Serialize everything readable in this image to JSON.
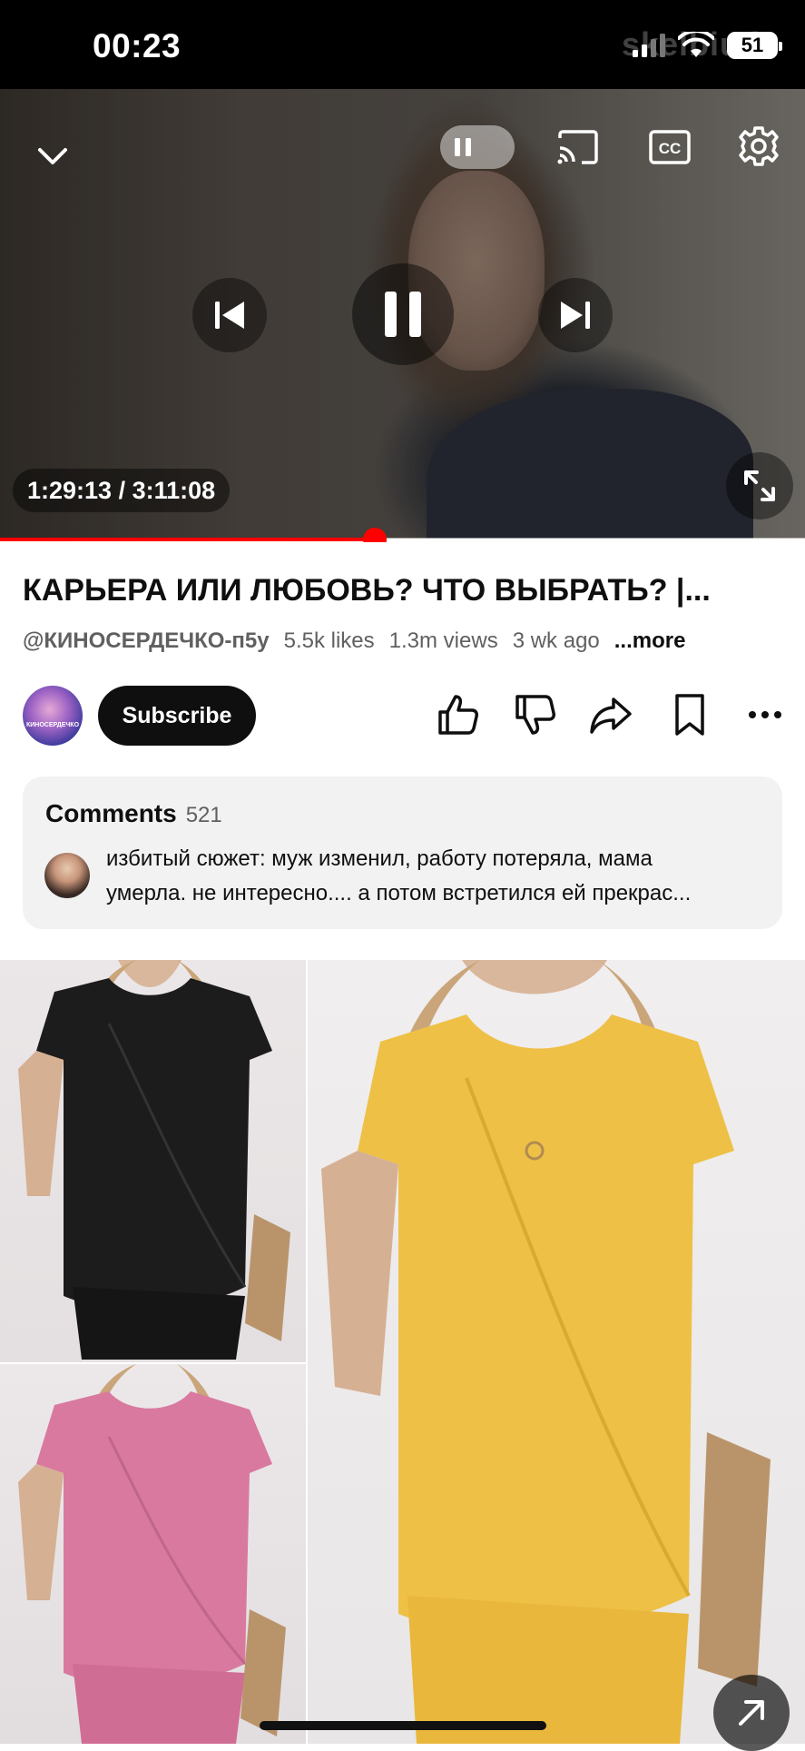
{
  "status_bar": {
    "time": "00:23",
    "battery": "51",
    "watermark": "skelbiu.lt"
  },
  "player": {
    "elapsed": "1:29:13",
    "duration": "3:11:08",
    "time_display": "1:29:13 / 3:11:08",
    "progress": 0.466,
    "controls": [
      "collapse-icon",
      "autoplay-toggle",
      "cast-icon",
      "captions-icon",
      "settings-icon",
      "previous-icon",
      "pause-icon",
      "next-icon",
      "fullscreen-icon"
    ]
  },
  "video": {
    "title": "КАРЬЕРА ИЛИ ЛЮБОВЬ? ЧТО ВЫБРАТЬ? |...",
    "channel": "@КИНОСЕРДЕЧКО-п5у",
    "likes": "5.5k likes",
    "views": "1.3m views",
    "age": "3 wk ago",
    "more": "...more"
  },
  "channel_avatar_text": "КИНОСЕРДЕЧКО",
  "actions": {
    "subscribe": "Subscribe"
  },
  "comments": {
    "label": "Comments",
    "count": "521",
    "top_comment_line1": "избитый сюжет: муж изменил, работу потеряла, мама",
    "top_comment_line2": "умерла. не интересно.... а потом встретился ей прекрас..."
  },
  "colors": {
    "accent": "#ff0000",
    "subscribe_bg": "#0f0f0f",
    "comments_bg": "#f2f2f2",
    "secondary_text": "#606060"
  }
}
